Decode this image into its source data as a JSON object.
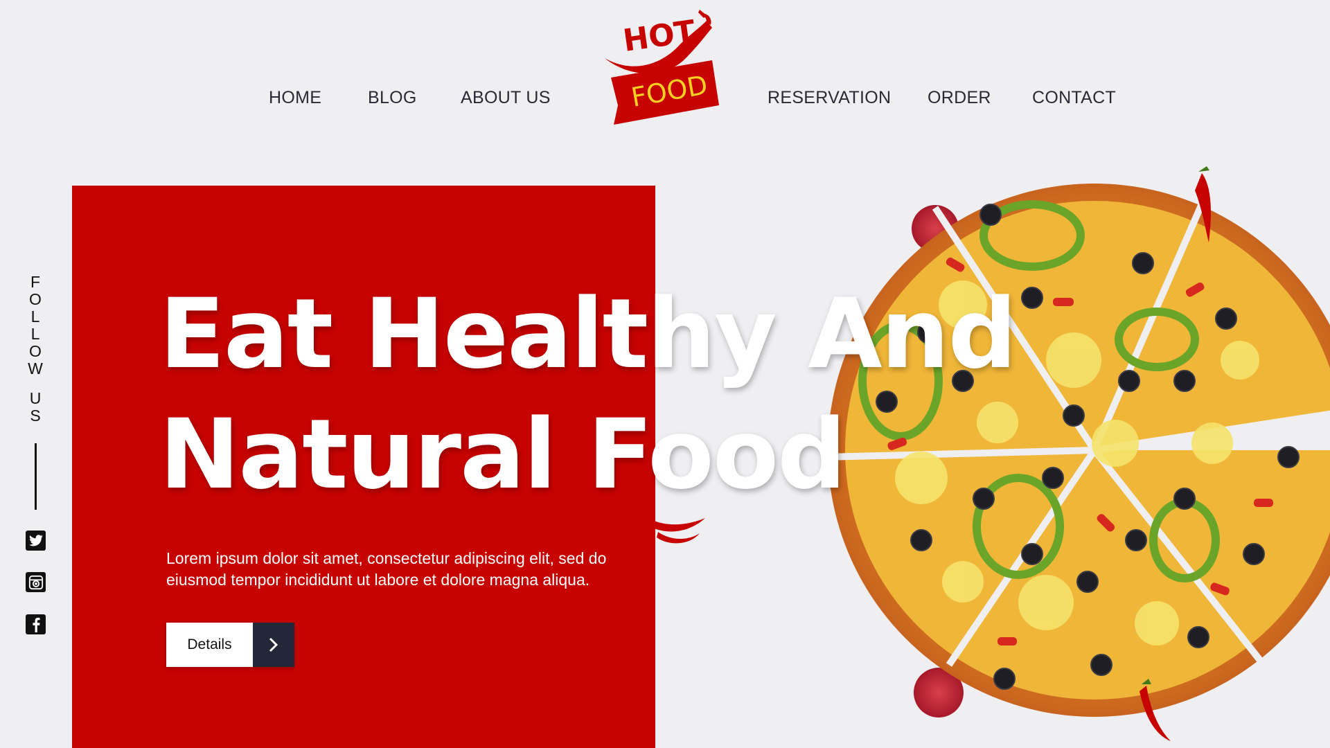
{
  "nav": {
    "left": [
      "HOME",
      "BLOG",
      "ABOUT US"
    ],
    "right": [
      "RESERVATION",
      "ORDER",
      "CONTACT"
    ]
  },
  "logo": {
    "top_text": "HOT",
    "bottom_text": "FOOD"
  },
  "social": {
    "follow_letters": [
      "F",
      "O",
      "L",
      "L",
      "O",
      "W",
      "",
      "U",
      "S"
    ],
    "icons": [
      "twitter-icon",
      "instagram-icon",
      "facebook-icon"
    ]
  },
  "hero": {
    "title_line1": "Eat Healthy And",
    "title_line2": "Natural Food",
    "description": "Lorem ipsum dolor sit amet, consectetur adipiscing elit, sed do eiusmod tempor incididunt ut labore et dolore magna aliqua.",
    "button_label": "Details"
  },
  "colors": {
    "accent_red": "#c70300",
    "background": "#efeef1",
    "button_dark": "#232838",
    "logo_yellow": "#f7d11e"
  }
}
